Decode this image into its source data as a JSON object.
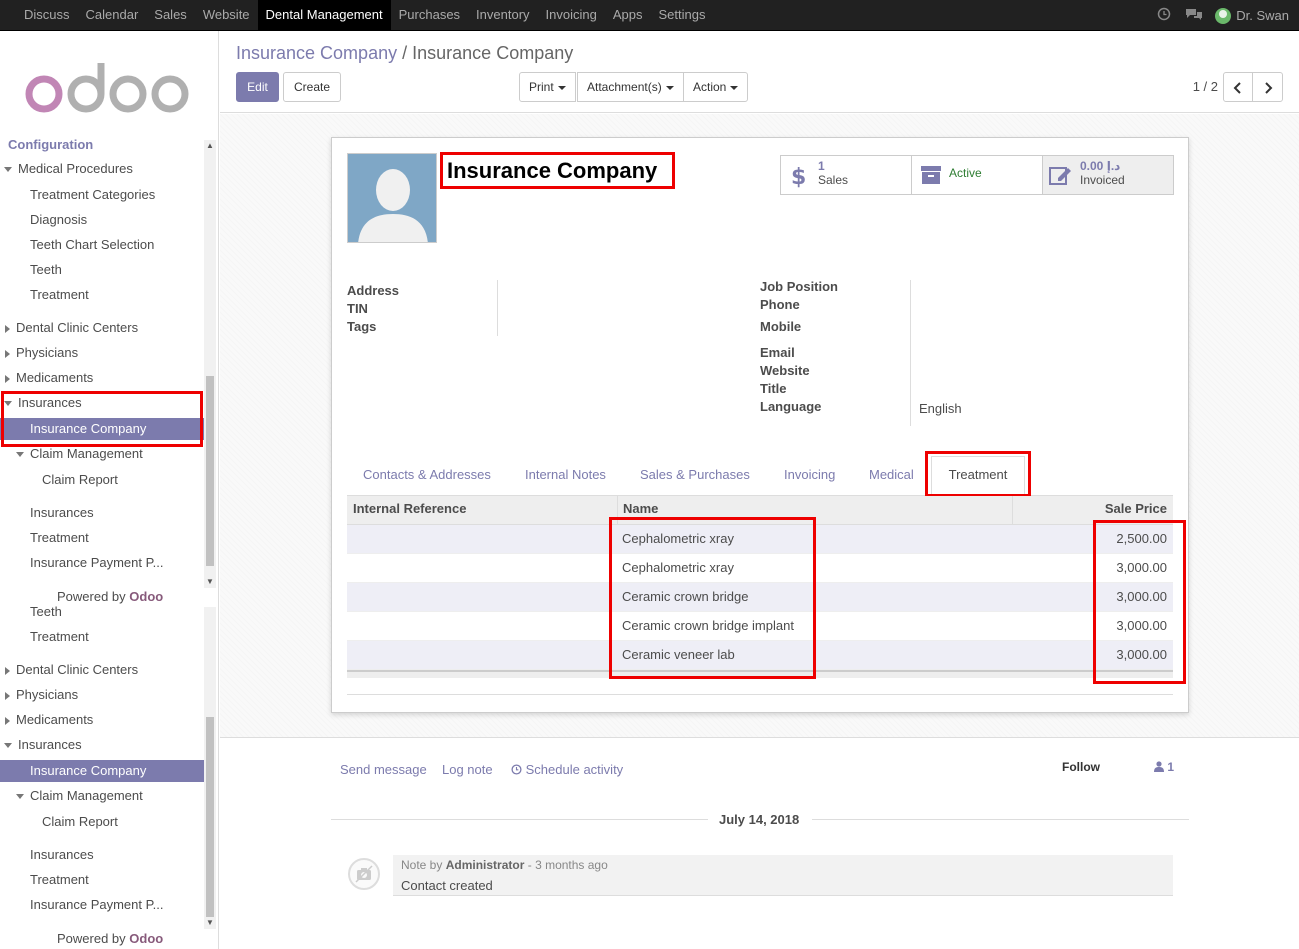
{
  "topbar": {
    "menu": [
      "Discuss",
      "Calendar",
      "Sales",
      "Website",
      "Dental Management",
      "Purchases",
      "Inventory",
      "Invoicing",
      "Apps",
      "Settings"
    ],
    "active_menu": "Dental Management",
    "user": "Dr. Swan"
  },
  "sidebar": {
    "section": "Configuration",
    "items": {
      "medical_procedures": "Medical Procedures",
      "treatment_categories": "Treatment Categories",
      "diagnosis": "Diagnosis",
      "teeth_chart_selection": "Teeth Chart Selection",
      "teeth": "Teeth",
      "treatment": "Treatment",
      "dental_clinic_centers": "Dental Clinic Centers",
      "physicians": "Physicians",
      "medicaments": "Medicaments",
      "insurances": "Insurances",
      "insurance_company": "Insurance Company",
      "claim_management": "Claim Management",
      "claim_report": "Claim Report",
      "insurances_sub": "Insurances",
      "treatment_sub": "Treatment",
      "insurance_payment": "Insurance Payment P..."
    },
    "powered_prefix": "Powered by",
    "powered_brand": "Odoo"
  },
  "breadcrumb": {
    "parent": "Insurance Company",
    "separator": "/",
    "current": "Insurance Company"
  },
  "buttons": {
    "edit": "Edit",
    "create": "Create",
    "print": "Print",
    "attachments": "Attachment(s)",
    "action": "Action"
  },
  "pager": "1 / 2",
  "record": {
    "name": "Insurance Company",
    "stats": {
      "sales_count": "1",
      "sales_label": "Sales",
      "active_label": "Active",
      "invoiced_amount": "0.00 د.إ",
      "invoiced_label": "Invoiced"
    },
    "fields_left": [
      "Address",
      "TIN",
      "Tags"
    ],
    "fields_right": [
      "Job Position",
      "Phone",
      "Mobile",
      "Email",
      "Website",
      "Title",
      "Language"
    ],
    "language_value": "English"
  },
  "tabs": [
    "Contacts & Addresses",
    "Internal Notes",
    "Sales & Purchases",
    "Invoicing",
    "Medical",
    "Treatment"
  ],
  "active_tab": "Treatment",
  "table": {
    "headers": [
      "Internal Reference",
      "Name",
      "Sale Price"
    ],
    "rows": [
      {
        "ref": "",
        "name": "Cephalometric xray",
        "price": "2,500.00"
      },
      {
        "ref": "",
        "name": "Cephalometric xray",
        "price": "3,000.00"
      },
      {
        "ref": "",
        "name": "Ceramic crown bridge",
        "price": "3,000.00"
      },
      {
        "ref": "",
        "name": "Ceramic crown bridge implant",
        "price": "3,000.00"
      },
      {
        "ref": "",
        "name": "Ceramic veneer lab",
        "price": "3,000.00"
      }
    ]
  },
  "chatter": {
    "send_message": "Send message",
    "log_note": "Log note",
    "schedule_activity": "Schedule activity",
    "follow": "Follow",
    "followers": "1",
    "date": "July 14, 2018",
    "note_prefix": "Note by",
    "note_author": "Administrator",
    "note_time": "- 3 months ago",
    "note_body": "Contact created"
  },
  "colors": {
    "accent": "#7c7bad",
    "highlight": "#ee0000",
    "topbar": "#212121"
  }
}
